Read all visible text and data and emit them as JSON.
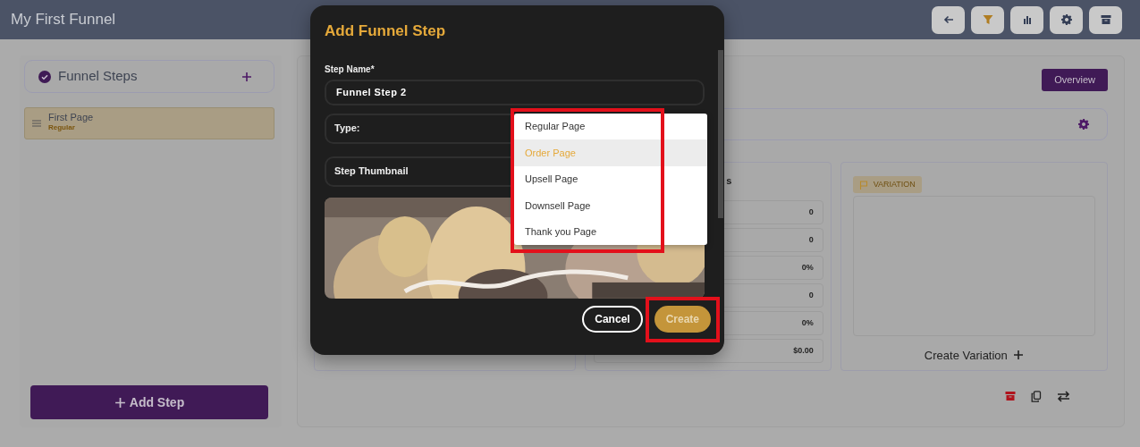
{
  "header": {
    "title": "My First Funnel",
    "actions": [
      {
        "kind": "back",
        "selected": false
      },
      {
        "kind": "funnel",
        "selected": true
      },
      {
        "kind": "stats",
        "selected": false
      },
      {
        "kind": "settings",
        "selected": false
      },
      {
        "kind": "archive",
        "selected": false
      }
    ]
  },
  "sidebar": {
    "title": "Funnel Steps",
    "steps": [
      {
        "name": "First Page",
        "type": "Regular",
        "selected": true
      }
    ],
    "add_button": "Add Step"
  },
  "main": {
    "overview_button": "Overview",
    "stats_card": {
      "title": "s",
      "rows": [
        "0",
        "0",
        "0%",
        "0",
        "0%",
        "$0.00"
      ]
    },
    "variation_card": {
      "badge": "VARIATION",
      "create_label": "Create Variation"
    },
    "row_actions": [
      {
        "kind": "archive"
      },
      {
        "kind": "copy"
      },
      {
        "kind": "swap"
      }
    ]
  },
  "modal": {
    "title": "Add Funnel Step",
    "fields": [
      {
        "kind": "text",
        "label": "Step Name*",
        "value": "Funnel Step 2"
      },
      {
        "kind": "select",
        "label": "Type:"
      },
      {
        "kind": "select",
        "label": "Step Thumbnail"
      }
    ],
    "dropdown": {
      "highlighted": true,
      "options": [
        {
          "label": "Regular Page",
          "selected": false
        },
        {
          "label": "Order Page",
          "selected": true
        },
        {
          "label": "Upsell Page",
          "selected": false
        },
        {
          "label": "Downsell Page",
          "selected": false
        },
        {
          "label": "Thank you Page",
          "selected": false
        }
      ]
    },
    "buttons": [
      {
        "kind": "cancel",
        "label": "Cancel"
      },
      {
        "kind": "create",
        "label": "Create",
        "highlighted": true
      }
    ]
  }
}
